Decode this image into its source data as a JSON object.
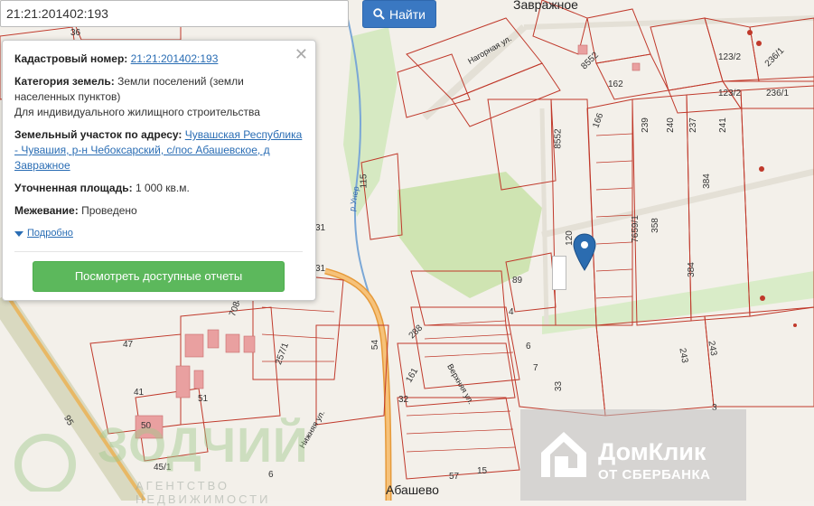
{
  "search": {
    "value": "21:21:201402:193",
    "button_label": "Найти"
  },
  "popup": {
    "cadastral_label": "Кадастровый номер:",
    "cadastral_value": "21:21:201402:193",
    "category_label": "Категория земель:",
    "category_value": "Земли поселений (земли населенных пунктов)",
    "usage": "Для индивидуального жилищного строительства",
    "address_label": "Земельный участок по адресу:",
    "address_value": "Чувашская Республика - Чувашия, р-н Чебоксарский, с/пос Абашевское, д Завражное",
    "area_label": "Уточненная площадь:",
    "area_value": "1 000 кв.м.",
    "survey_label": "Межевание:",
    "survey_value": "Проведено",
    "more_link": "Подробно",
    "reports_button": "Посмотреть доступные отчеты",
    "close_symbol": "✕"
  },
  "map": {
    "places": {
      "zavrazhnoe": "Завражное",
      "abashevo": "Абашево"
    },
    "streets": {
      "nagornaya": "Нагорная ул.",
      "verkhnyaya": "Верхняя ул.",
      "nizhnyaya": "Нижняя ул.",
      "river": "р.Унер"
    },
    "plot_numbers": [
      "36",
      "123/2",
      "236/1",
      "8552",
      "162",
      "123/2",
      "236/1",
      "166",
      "239",
      "240",
      "237",
      "241",
      "8552",
      "384",
      "7659/1",
      "120",
      "358",
      "384",
      "89",
      "4",
      "7084",
      "257/1",
      "54",
      "288",
      "6",
      "7",
      "47",
      "51",
      "41",
      "161",
      "32",
      "33",
      "243",
      "243",
      "50",
      "45/1",
      "95",
      "6",
      "57",
      "15",
      "115",
      "31",
      "31",
      "3"
    ]
  },
  "ads": {
    "domclick_brand": "ДомКлик",
    "domclick_sub": "ОТ СБЕРБАНКА",
    "zodchiy_brand": "ЗОДЧИЙ",
    "zodchiy_sub": "АГЕНТСТВО НЕДВИЖИМОСТИ"
  },
  "icons": {
    "search": "search-icon",
    "close": "close-icon",
    "marker": "map-marker-icon"
  },
  "colors": {
    "primary_button": "#3a78c2",
    "report_button": "#5cb85c",
    "plot_lines": "#c0392b",
    "marker": "#2b6cb0"
  }
}
